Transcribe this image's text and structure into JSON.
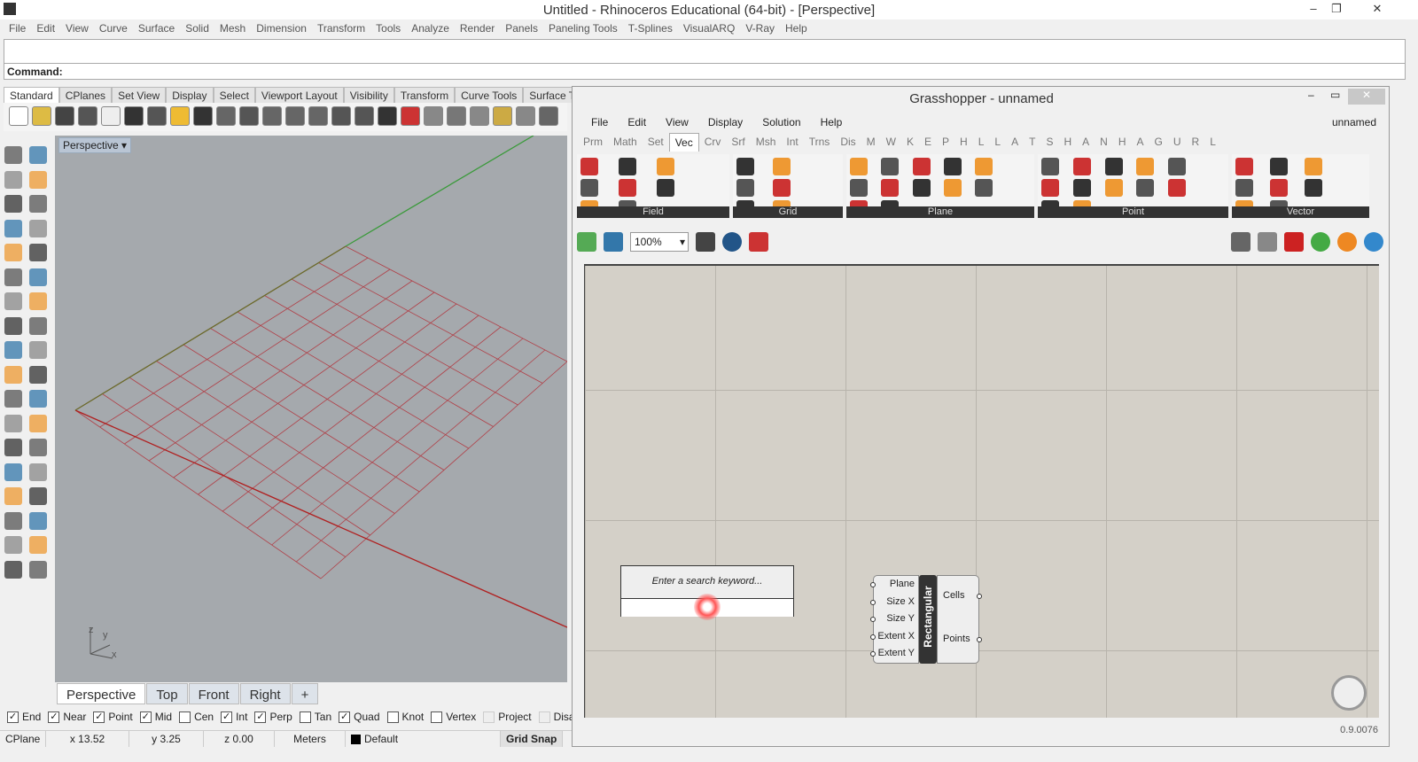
{
  "window": {
    "title": "Untitled - Rhinoceros Educational (64-bit) - [Perspective]"
  },
  "menu": [
    "File",
    "Edit",
    "View",
    "Curve",
    "Surface",
    "Solid",
    "Mesh",
    "Dimension",
    "Transform",
    "Tools",
    "Analyze",
    "Render",
    "Panels",
    "Paneling Tools",
    "T-Splines",
    "VisualARQ",
    "V-Ray",
    "Help"
  ],
  "command": {
    "label": "Command:"
  },
  "toolbar_tabs": [
    "Standard",
    "CPlanes",
    "Set View",
    "Display",
    "Select",
    "Viewport Layout",
    "Visibility",
    "Transform",
    "Curve Tools",
    "Surface Tool"
  ],
  "viewport": {
    "label": "Perspective",
    "axis_y": "y",
    "axis_x": "x",
    "axis_z": "z"
  },
  "viewport_tabs": [
    "Perspective",
    "Top",
    "Front",
    "Right",
    "+"
  ],
  "osnaps": [
    {
      "label": "End",
      "checked": true
    },
    {
      "label": "Near",
      "checked": true
    },
    {
      "label": "Point",
      "checked": true
    },
    {
      "label": "Mid",
      "checked": true
    },
    {
      "label": "Cen",
      "checked": false
    },
    {
      "label": "Int",
      "checked": true
    },
    {
      "label": "Perp",
      "checked": true
    },
    {
      "label": "Tan",
      "checked": false
    },
    {
      "label": "Quad",
      "checked": true
    },
    {
      "label": "Knot",
      "checked": false
    },
    {
      "label": "Vertex",
      "checked": false
    },
    {
      "label": "Project",
      "checked": false,
      "disabled": true
    },
    {
      "label": "Disable",
      "checked": false,
      "disabled": true
    }
  ],
  "status": {
    "cplane": "CPlane",
    "x": "x 13.52",
    "y": "y 3.25",
    "z": "z 0.00",
    "units": "Meters",
    "layer": "Default",
    "grid_snap": "Grid Snap"
  },
  "grasshopper": {
    "title": "Grasshopper - unnamed",
    "doc": "unnamed",
    "menu": [
      "File",
      "Edit",
      "View",
      "Display",
      "Solution",
      "Help"
    ],
    "tabs": [
      "Prm",
      "Math",
      "Set",
      "Vec",
      "Crv",
      "Srf",
      "Msh",
      "Int",
      "Trns",
      "Dis",
      "M",
      "W",
      "K",
      "E",
      "P",
      "H",
      "L",
      "L",
      "A",
      "T",
      "S",
      "H",
      "A",
      "N",
      "H",
      "A",
      "G",
      "U",
      "R",
      "L"
    ],
    "active_tab": "Vec",
    "groups": [
      "Field",
      "Grid",
      "Plane",
      "Point",
      "Vector"
    ],
    "zoom": "100%",
    "search_placeholder": "Enter a search keyword...",
    "component": {
      "name": "Rectangular",
      "inputs": [
        "Plane",
        "Size X",
        "Size Y",
        "Extent X",
        "Extent Y"
      ],
      "outputs": [
        "Cells",
        "Points"
      ]
    },
    "version": "0.9.0076"
  }
}
